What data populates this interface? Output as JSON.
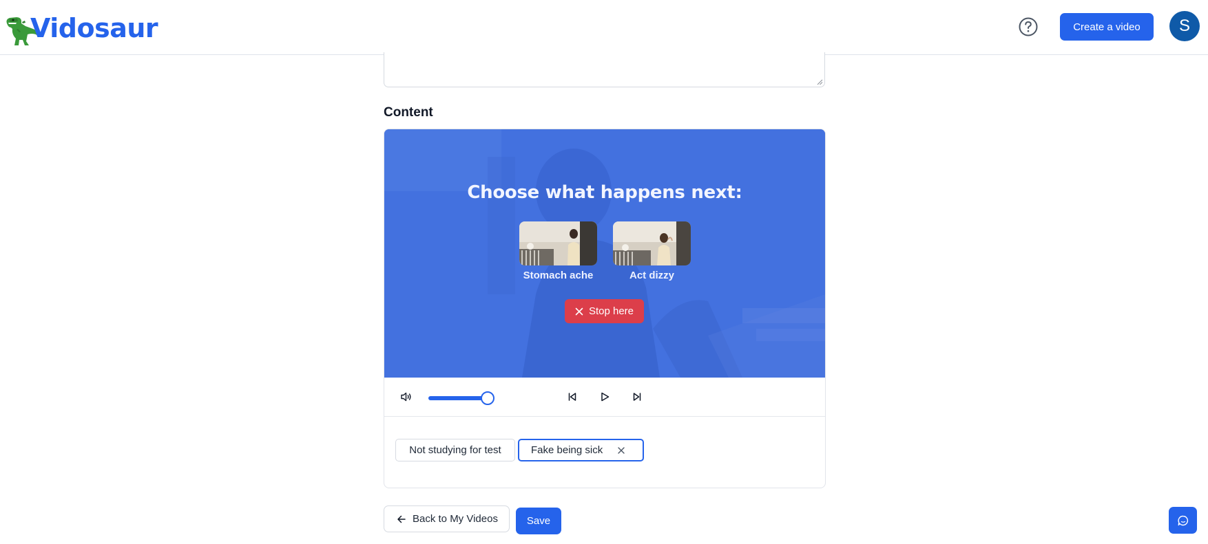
{
  "header": {
    "brand": "Vidosaur",
    "create_label": "Create a video",
    "avatar_initial": "S"
  },
  "editor": {
    "section_label": "Content"
  },
  "player": {
    "prompt": "Choose what happens next:",
    "choices": [
      {
        "label": "Stomach ache"
      },
      {
        "label": "Act dizzy"
      }
    ],
    "stop_label": "Stop here",
    "volume_level": 0.9
  },
  "tags": [
    {
      "label": "Not studying for test",
      "active": false
    },
    {
      "label": "Fake being sick",
      "active": true
    }
  ],
  "footer": {
    "back_label": "Back to My Videos",
    "save_label": "Save"
  },
  "colors": {
    "accent": "#2563eb",
    "overlay": "#4371df",
    "stop": "#dc3e4a",
    "avatar": "#0f5aa8"
  }
}
